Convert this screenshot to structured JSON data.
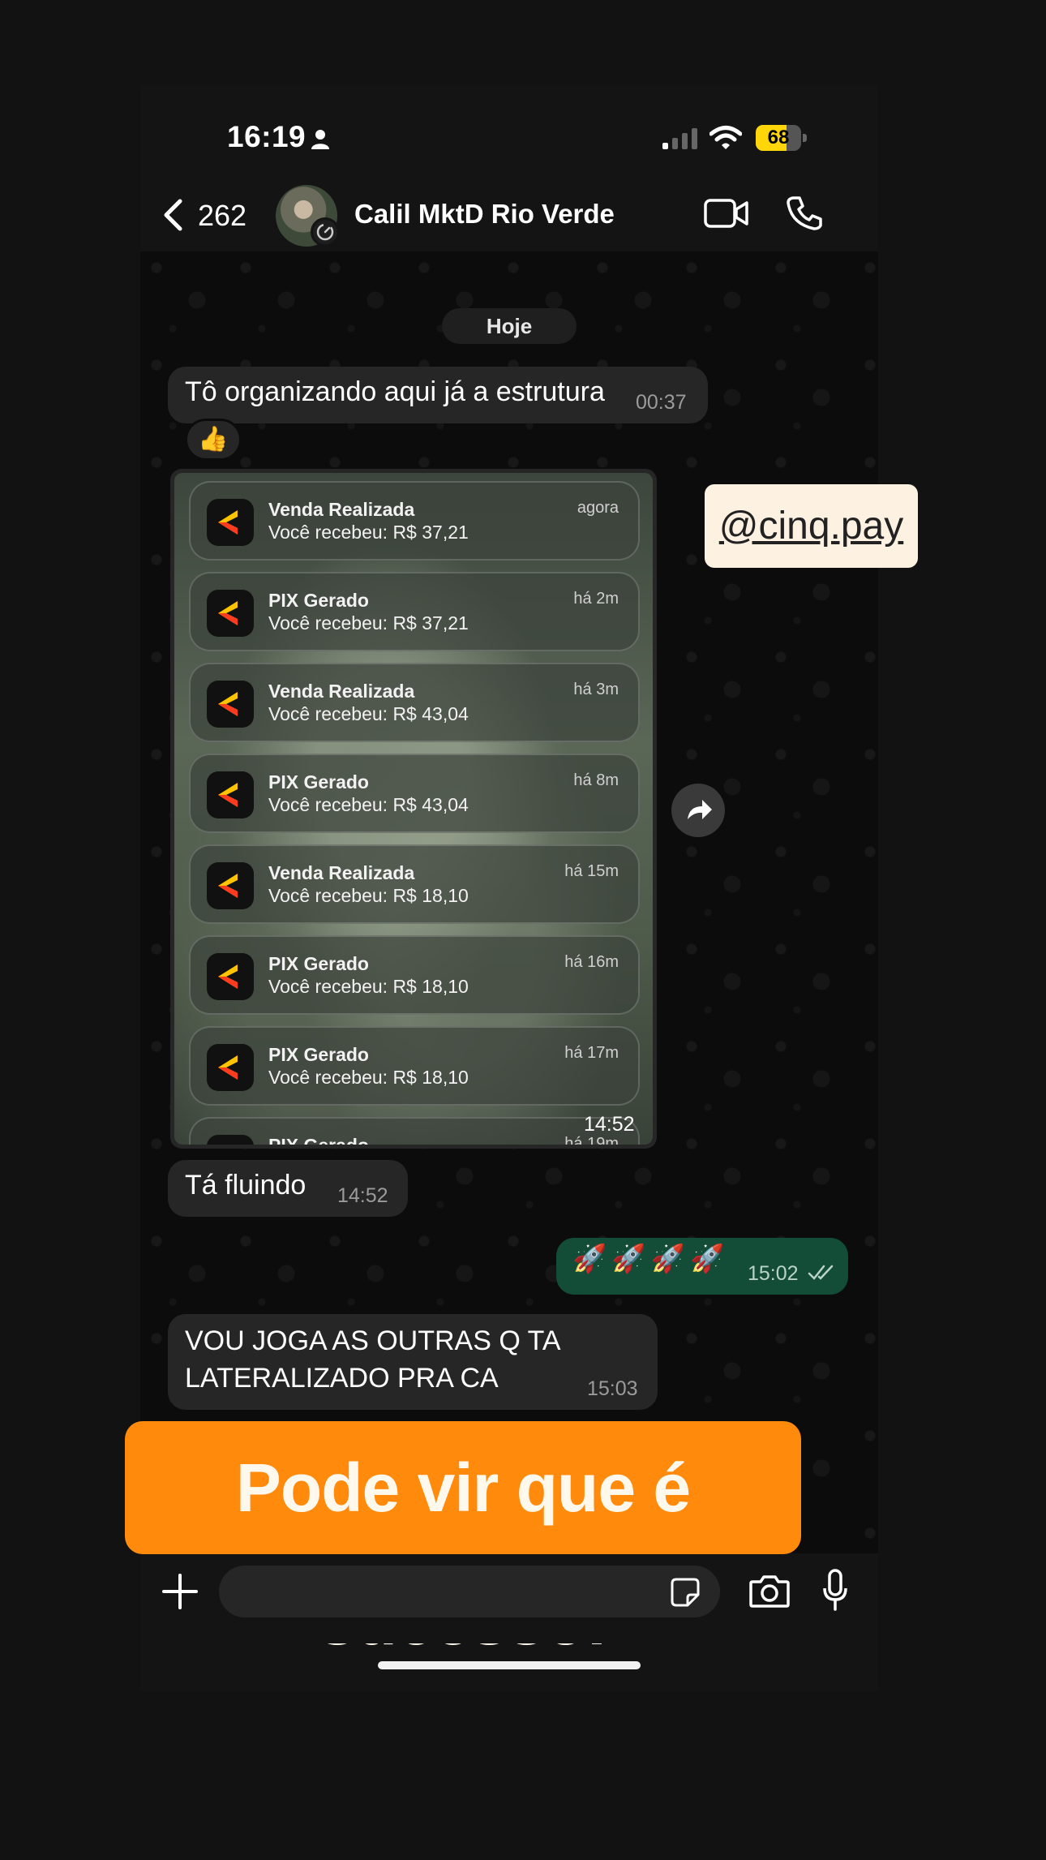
{
  "status_bar": {
    "time": "16:19",
    "battery_level": "68",
    "battery_fraction": 0.68,
    "icons": [
      "person-icon",
      "signal-icon",
      "wifi-icon",
      "battery-icon"
    ]
  },
  "header": {
    "back_count": "262",
    "contact_name": "Calil MktD Rio Verde",
    "icons": [
      "chevron-left-icon",
      "video-call-icon",
      "phone-call-icon"
    ]
  },
  "chat": {
    "date_separator": "Hoje",
    "messages": [
      {
        "text": "Tô organizando aqui já a estrutura",
        "time": "00:37",
        "reaction": "👍"
      },
      {
        "time": "14:52"
      },
      {
        "text": "Tá fluindo",
        "time": "14:52"
      },
      {
        "text": "🚀🚀🚀🚀",
        "time": "15:02"
      },
      {
        "text": "VOU JOGA AS OUTRAS Q TA\nLATERALIZADO PRA CA",
        "time": "15:03"
      }
    ],
    "notifications": [
      {
        "title": "Venda Realizada",
        "body": "Você recebeu: R$ 37,21",
        "when": "agora"
      },
      {
        "title": "PIX Gerado",
        "body": "Você recebeu: R$ 37,21",
        "when": "há 2m"
      },
      {
        "title": "Venda Realizada",
        "body": "Você recebeu: R$ 43,04",
        "when": "há 3m"
      },
      {
        "title": "PIX Gerado",
        "body": "Você recebeu: R$ 43,04",
        "when": "há 8m"
      },
      {
        "title": "Venda Realizada",
        "body": "Você recebeu: R$ 18,10",
        "when": "há 15m"
      },
      {
        "title": "PIX Gerado",
        "body": "Você recebeu: R$ 18,10",
        "when": "há 16m"
      },
      {
        "title": "PIX Gerado",
        "body": "Você recebeu: R$ 18,10",
        "when": "há 17m"
      },
      {
        "title": "PIX Gerado",
        "body": "",
        "when": "há 19m"
      }
    ]
  },
  "overlay": {
    "handle": "@cinq.pay",
    "banner": "Pode vir que é sucesso!"
  },
  "composer": {
    "placeholder": "",
    "icons": [
      "plus-icon",
      "sticker-icon",
      "camera-icon",
      "microphone-icon"
    ]
  },
  "colors": {
    "incoming_bubble": "#262626",
    "outgoing_bubble": "#144d37",
    "banner": "#ff8a0c",
    "battery": "#ffd60a"
  }
}
